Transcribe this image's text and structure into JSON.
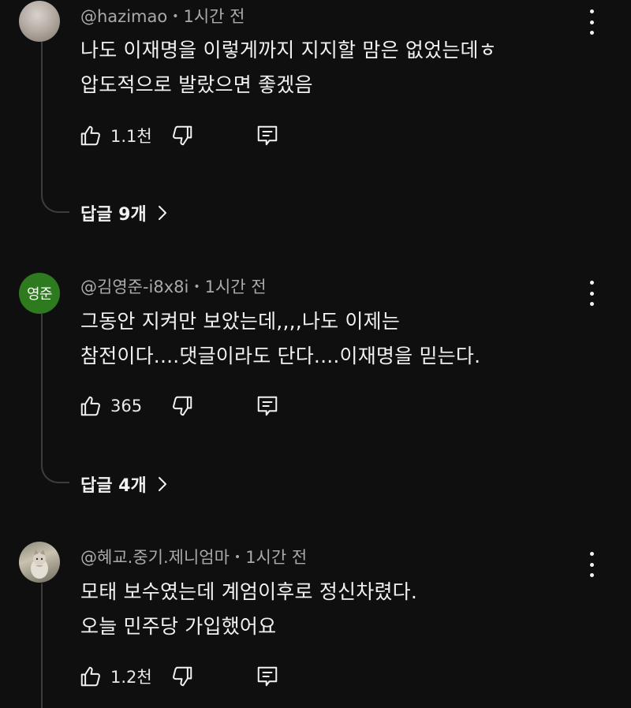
{
  "comments": [
    {
      "author": "@hazimao",
      "time": "1시간 전",
      "lines": [
        "나도 이재명을 이렇게까지 지지할 맘은 없었는데ㅎ",
        "압도적으로 발랐으면 좋겠음"
      ],
      "likes": "1.1천",
      "replies_label": "답글 9개"
    },
    {
      "author": "@김영준-i8x8i",
      "avatar_initials": "영준",
      "avatar_color": "#2d7a1f",
      "time": "1시간 전",
      "lines": [
        "그동안 지켜만 보았는데,,,,나도 이제는",
        "참전이다....댓글이라도 단다....이재명을 믿는다."
      ],
      "likes": "365",
      "replies_label": "답글 4개"
    },
    {
      "author": "@혜교.중기.제니엄마",
      "time": "1시간 전",
      "lines": [
        "모태 보수였는데 계엄이후로 정신차렸다.",
        "오늘 민주당 가입했어요"
      ],
      "likes": "1.2천"
    }
  ],
  "icons": {
    "like": "thumbs-up-icon",
    "dislike": "thumbs-down-icon",
    "reply": "comment-reply-icon",
    "more": "more-vert-icon",
    "chevron": "chevron-right-icon"
  },
  "colors": {
    "background": "#0f0f0f",
    "text": "#f1f1f1",
    "meta": "#aaaaaa",
    "thread": "#3d3d3d"
  }
}
